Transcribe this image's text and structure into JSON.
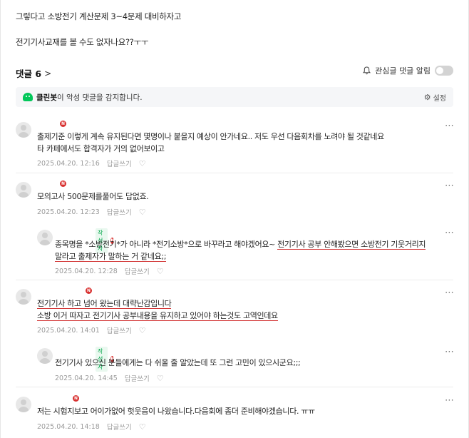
{
  "post": {
    "line1": "그렇다고 소방전기 계산문제 3~4문제 대비하자고",
    "line2": "전기기사교재를 볼 수도 없자나요??ㅜㅜ"
  },
  "comments_header": {
    "label": "댓글 6",
    "chevron": ">"
  },
  "watch": {
    "label": "관심글 댓글 알림",
    "toggle_on": false
  },
  "cleanbot": {
    "name": "클린봇",
    "message": "이 악성 댓글을 감지합니다.",
    "settings_label": "설정"
  },
  "comments": [
    {
      "badge": "N",
      "line1": "출제기준 이렇게 계속 유지된다면 몇명이나 붙을지 예상이 안가네요.. 저도 우선 다음회차를 노려야 될 것같네요",
      "line2": "타 카페에서도 합격자가 거의 없어보이고",
      "date": "2025.04.20. 12:16",
      "reply_label": "답글쓰기"
    },
    {
      "badge": "N",
      "line1": "모의고사 500문제를풀어도 답없죠.",
      "date": "2025.04.20. 12:23",
      "reply_label": "답글쓰기"
    },
    {
      "author_badge": "작성자",
      "badge": "N",
      "line1_plain": "종목명을 *소방전기*가 아니라 *전기소방*으로 바꾸라고 해야겠어요~",
      "line1_underlined": "전기기사 공부 안해봤으면 소방전기 기웃거리지",
      "line2": "말라고 출제자가 말하는 거 같네요;;",
      "date": "2025.04.20. 12:28",
      "reply_label": "답글쓰기"
    },
    {
      "badge": "N",
      "line1": "전기기사 하고 넘어 왔는데 대략난감입니다",
      "line2": "소방 이거 따자고 전기기사 공부내용을 유지하고 있어야 하는것도 고역인데요",
      "date": "2025.04.20. 14:01",
      "reply_label": "답글쓰기"
    },
    {
      "author_badge": "작성자",
      "badge": "N",
      "line1": "전기기사 있으신 분들에게는 다 쉬울 줄 알았는데 또 그런 고민이 있으시군요;;;",
      "date": "2025.04.20. 14:45",
      "reply_label": "답글쓰기"
    },
    {
      "badge": "N",
      "line1": "저는 시험지보고 어이가없어 헛웃음이 나왔습니다.다음회에 좀더 준비해야겠습니다. ㅠㅠ",
      "date": "2025.04.20. 14:18",
      "reply_label": "답글쓰기"
    }
  ]
}
